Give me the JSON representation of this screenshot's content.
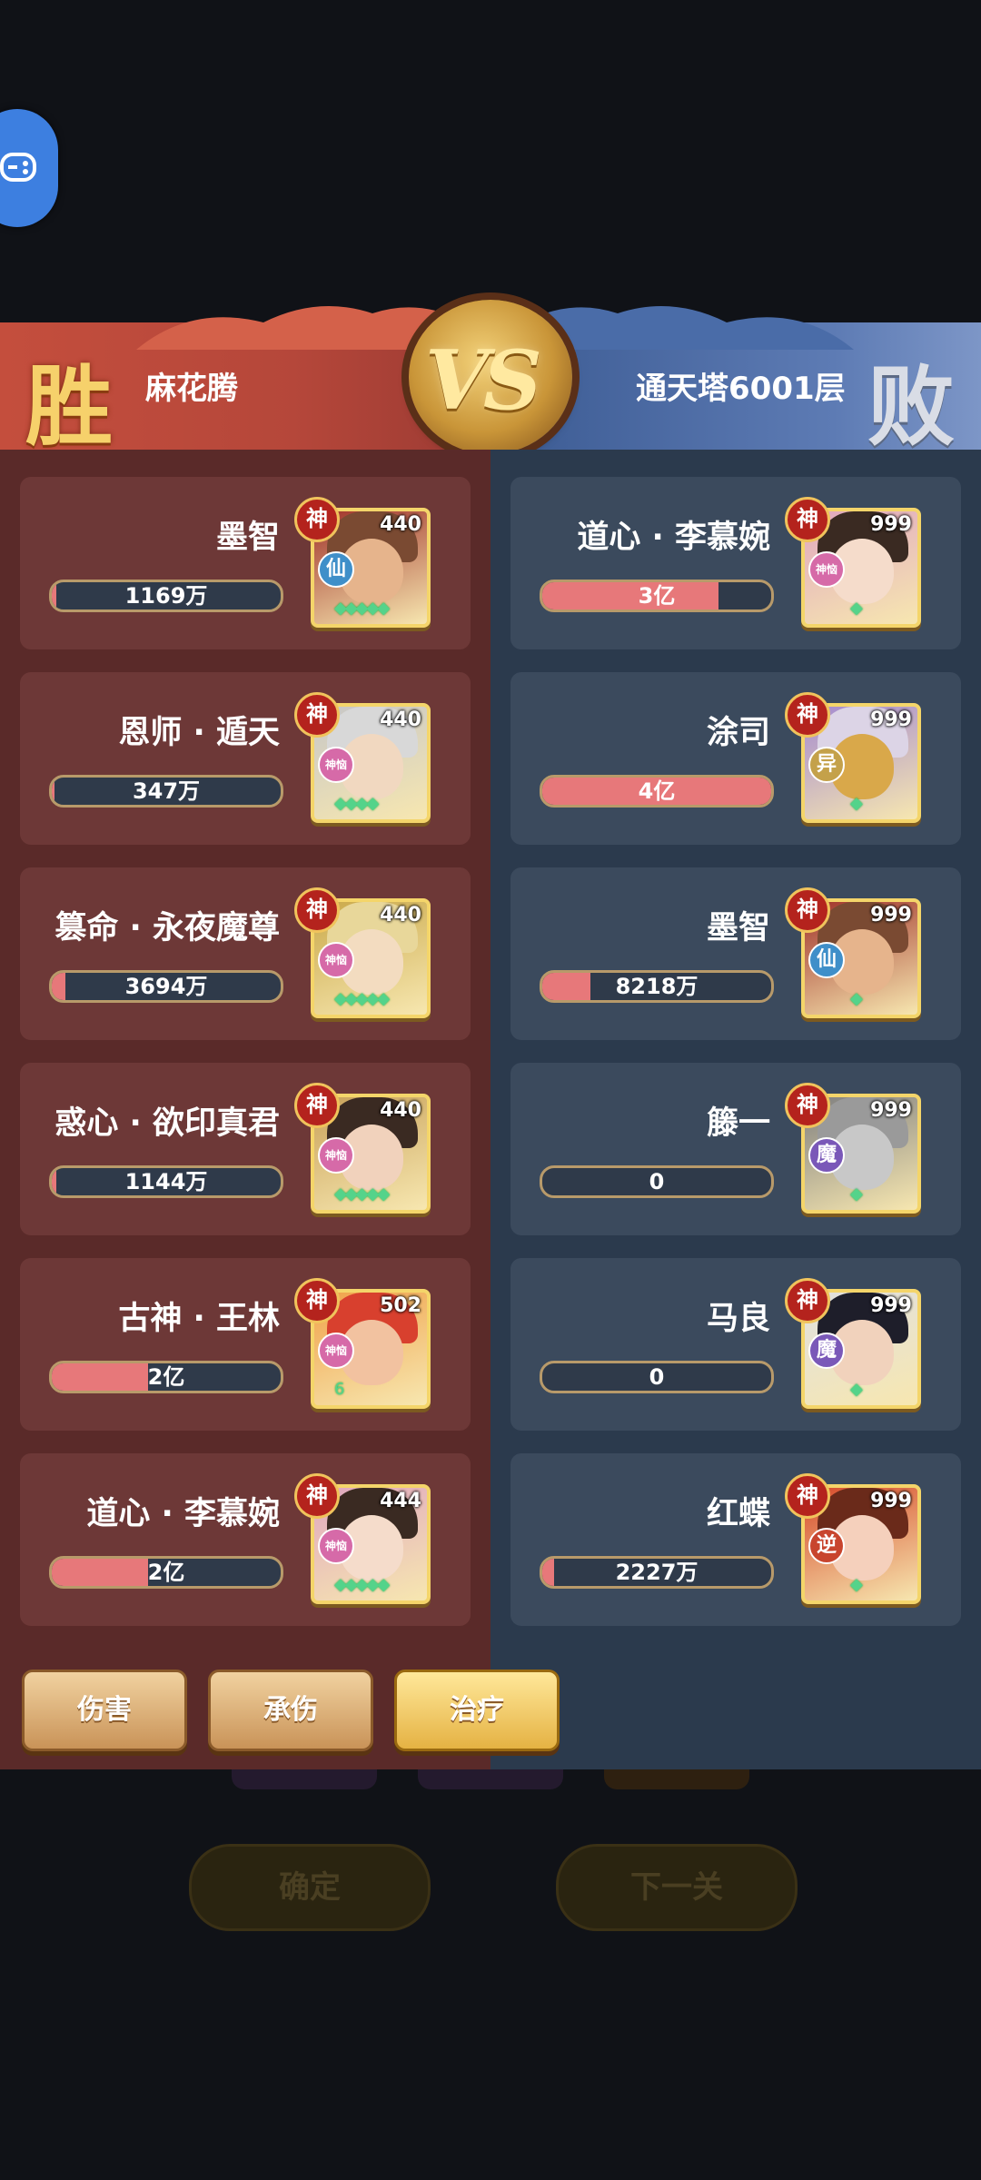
{
  "header": {
    "win_label": "胜",
    "lose_label": "败",
    "player_name": "麻花腾",
    "enemy_name": "通天塔6001层",
    "vs_label": "VS"
  },
  "left_team": [
    {
      "name": "墨智",
      "level": "440",
      "rank": "神",
      "faction": "仙",
      "faction_color": "#3f8fc9",
      "bar_label": "1169万",
      "bar_fill": 0.02,
      "stars": "◆◆◆◆◆"
    },
    {
      "name": "恩师 · 遁天",
      "level": "440",
      "rank": "神",
      "faction": "神恼",
      "faction_color": "#d66aa8",
      "bar_label": "347万",
      "bar_fill": 0.01,
      "stars": "◆◆◆◆"
    },
    {
      "name": "篡命 · 永夜魔尊",
      "level": "440",
      "rank": "神",
      "faction": "神恼",
      "faction_color": "#d66aa8",
      "bar_label": "3694万",
      "bar_fill": 0.06,
      "stars": "◆◆◆◆◆"
    },
    {
      "name": "惑心 · 欲印真君",
      "level": "440",
      "rank": "神",
      "faction": "神恼",
      "faction_color": "#d66aa8",
      "bar_label": "1144万",
      "bar_fill": 0.02,
      "stars": "◆◆◆◆◆"
    },
    {
      "name": "古神 · 王林",
      "level": "502",
      "rank": "神",
      "faction": "神恼",
      "faction_color": "#d66aa8",
      "bar_label": "2亿",
      "bar_fill": 0.42,
      "stars": "6"
    },
    {
      "name": "道心 · 李慕婉",
      "level": "444",
      "rank": "神",
      "faction": "神恼",
      "faction_color": "#d66aa8",
      "bar_label": "2亿",
      "bar_fill": 0.42,
      "stars": "◆◆◆◆◆"
    }
  ],
  "right_team": [
    {
      "name": "道心 · 李慕婉",
      "level": "999",
      "rank": "神",
      "faction": "神恼",
      "faction_color": "#d66aa8",
      "bar_label": "3亿",
      "bar_fill": 0.77,
      "stars": "◆"
    },
    {
      "name": "涂司",
      "level": "999",
      "rank": "神",
      "faction": "异",
      "faction_color": "#c4a14a",
      "bar_label": "4亿",
      "bar_fill": 1.0,
      "stars": "◆"
    },
    {
      "name": "墨智",
      "level": "999",
      "rank": "神",
      "faction": "仙",
      "faction_color": "#3f8fc9",
      "bar_label": "8218万",
      "bar_fill": 0.21,
      "stars": "◆"
    },
    {
      "name": "籐一",
      "level": "999",
      "rank": "神",
      "faction": "魔",
      "faction_color": "#7a58b8",
      "bar_label": "0",
      "bar_fill": 0,
      "stars": "◆"
    },
    {
      "name": "马良",
      "level": "999",
      "rank": "神",
      "faction": "魔",
      "faction_color": "#7a58b8",
      "bar_label": "0",
      "bar_fill": 0,
      "stars": "◆"
    },
    {
      "name": "红蝶",
      "level": "999",
      "rank": "神",
      "faction": "逆",
      "faction_color": "#c8452e",
      "bar_label": "2227万",
      "bar_fill": 0.05,
      "stars": "◆"
    }
  ],
  "tabs": [
    {
      "label": "伤害",
      "active": false
    },
    {
      "label": "承伤",
      "active": false
    },
    {
      "label": "治疗",
      "active": true
    }
  ],
  "background_buttons": {
    "confirm": "确定",
    "next": "下一关"
  },
  "colors": {
    "win_panel": "#5a2a29",
    "lose_panel": "#2b3a4d",
    "bar_fill": "#e7787a",
    "avatar_frame": "#f4d56a"
  }
}
